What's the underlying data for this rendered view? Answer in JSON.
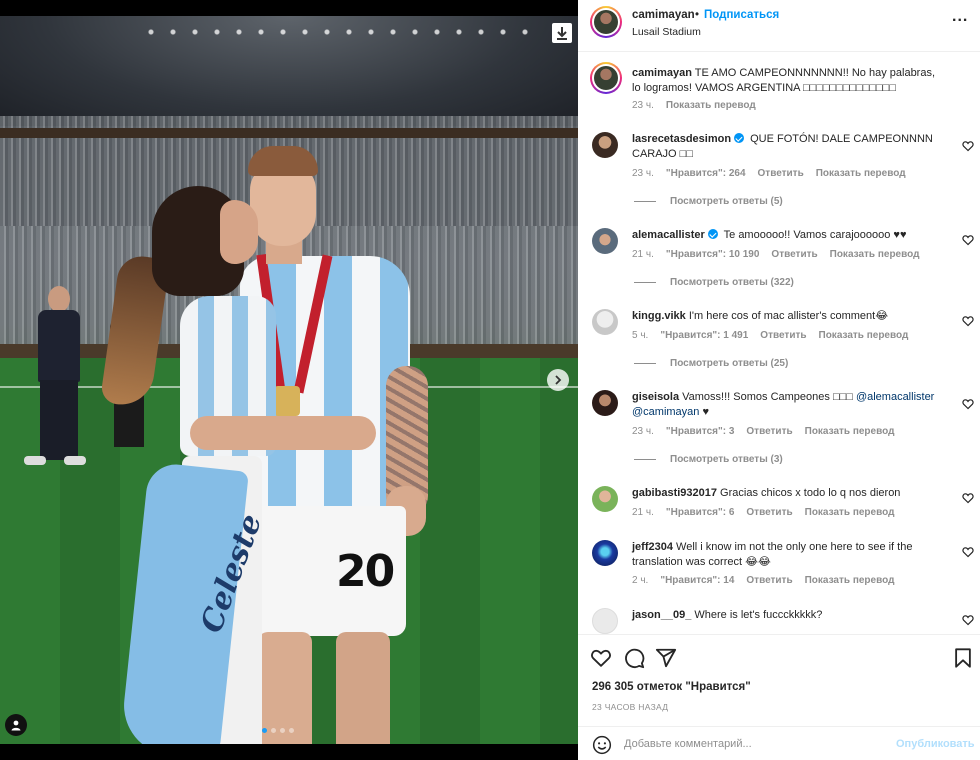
{
  "post": {
    "username": "camimayan",
    "dot": "•",
    "follow_label": "Подписаться",
    "location": "Lusail Stadium",
    "more": "..."
  },
  "photo": {
    "jersey_number": "20",
    "flag_text": "Celeste",
    "carousel_count": 4,
    "carousel_active": 1
  },
  "caption": {
    "username": "camimayan",
    "text": " TE AMO CAMPEONNNNNNN!! No hay palabras, lo logramos! VAMOS ARGENTINA □□□□□□□□□□□□□□",
    "time": "23 ч.",
    "translate": "Показать перевод"
  },
  "comments": [
    {
      "username": "lasrecetasdesimon",
      "verified": true,
      "text": " QUE FOTÓN! DALE CAMPEONNNN CARAJO □□",
      "time": "23 ч.",
      "likes": "\"Нравится\": 264",
      "reply": "Ответить",
      "translate": "Показать перевод",
      "replies": "Посмотреть ответы (5)"
    },
    {
      "username": "alemacallister",
      "verified": true,
      "text": " Te amooooo!! Vamos carajoooooo ♥♥",
      "time": "21 ч.",
      "likes": "\"Нравится\": 10 190",
      "reply": "Ответить",
      "translate": "Показать перевод",
      "replies": "Посмотреть ответы (322)"
    },
    {
      "username": "kingg.vikk",
      "verified": false,
      "text": " I'm here cos of mac allister's comment😂",
      "time": "5 ч.",
      "likes": "\"Нравится\": 1 491",
      "reply": "Ответить",
      "translate": "Показать перевод",
      "replies": "Посмотреть ответы (25)"
    },
    {
      "username": "giseisola",
      "verified": false,
      "text": " Vamoss!!! Somos Campeones □□□ ",
      "mention1": "@alemacallister",
      "mention2": "@camimayan",
      "text_end": " ♥",
      "time": "23 ч.",
      "likes": "\"Нравится\": 3",
      "reply": "Ответить",
      "translate": "Показать перевод",
      "replies": "Посмотреть ответы (3)"
    },
    {
      "username": "gabibasti932017",
      "verified": false,
      "text": " Gracias chicos x todo lo q nos dieron",
      "time": "21 ч.",
      "likes": "\"Нравится\": 6",
      "reply": "Ответить",
      "translate": "Показать перевод"
    },
    {
      "username": "jeff2304",
      "verified": false,
      "text": " Well i know im not the only one here to see if the translation was correct 😂😂",
      "time": "2 ч.",
      "likes": "\"Нравится\": 14",
      "reply": "Ответить",
      "translate": "Показать перевод"
    },
    {
      "username": "jason__09_",
      "verified": false,
      "text": " Where is let's fuccckkkkk?"
    }
  ],
  "stats": {
    "likes": "296 305 отметок \"Нравится\"",
    "time": "23 ЧАСОВ НАЗАД"
  },
  "add_comment": {
    "placeholder": "Добавьте комментарий...",
    "publish": "Опубликовать"
  },
  "icons": {
    "like": "heart-icon",
    "comment": "comment-icon",
    "share": "share-icon",
    "save": "bookmark-icon",
    "emoji": "emoji-icon",
    "download": "download-icon",
    "next": "chevron-right-icon",
    "tagged": "user-tag-icon"
  },
  "colors": {
    "accent": "#0095f6",
    "publish_disabled": "#b2dffc",
    "text": "#262626",
    "muted": "#8e8e8e"
  }
}
